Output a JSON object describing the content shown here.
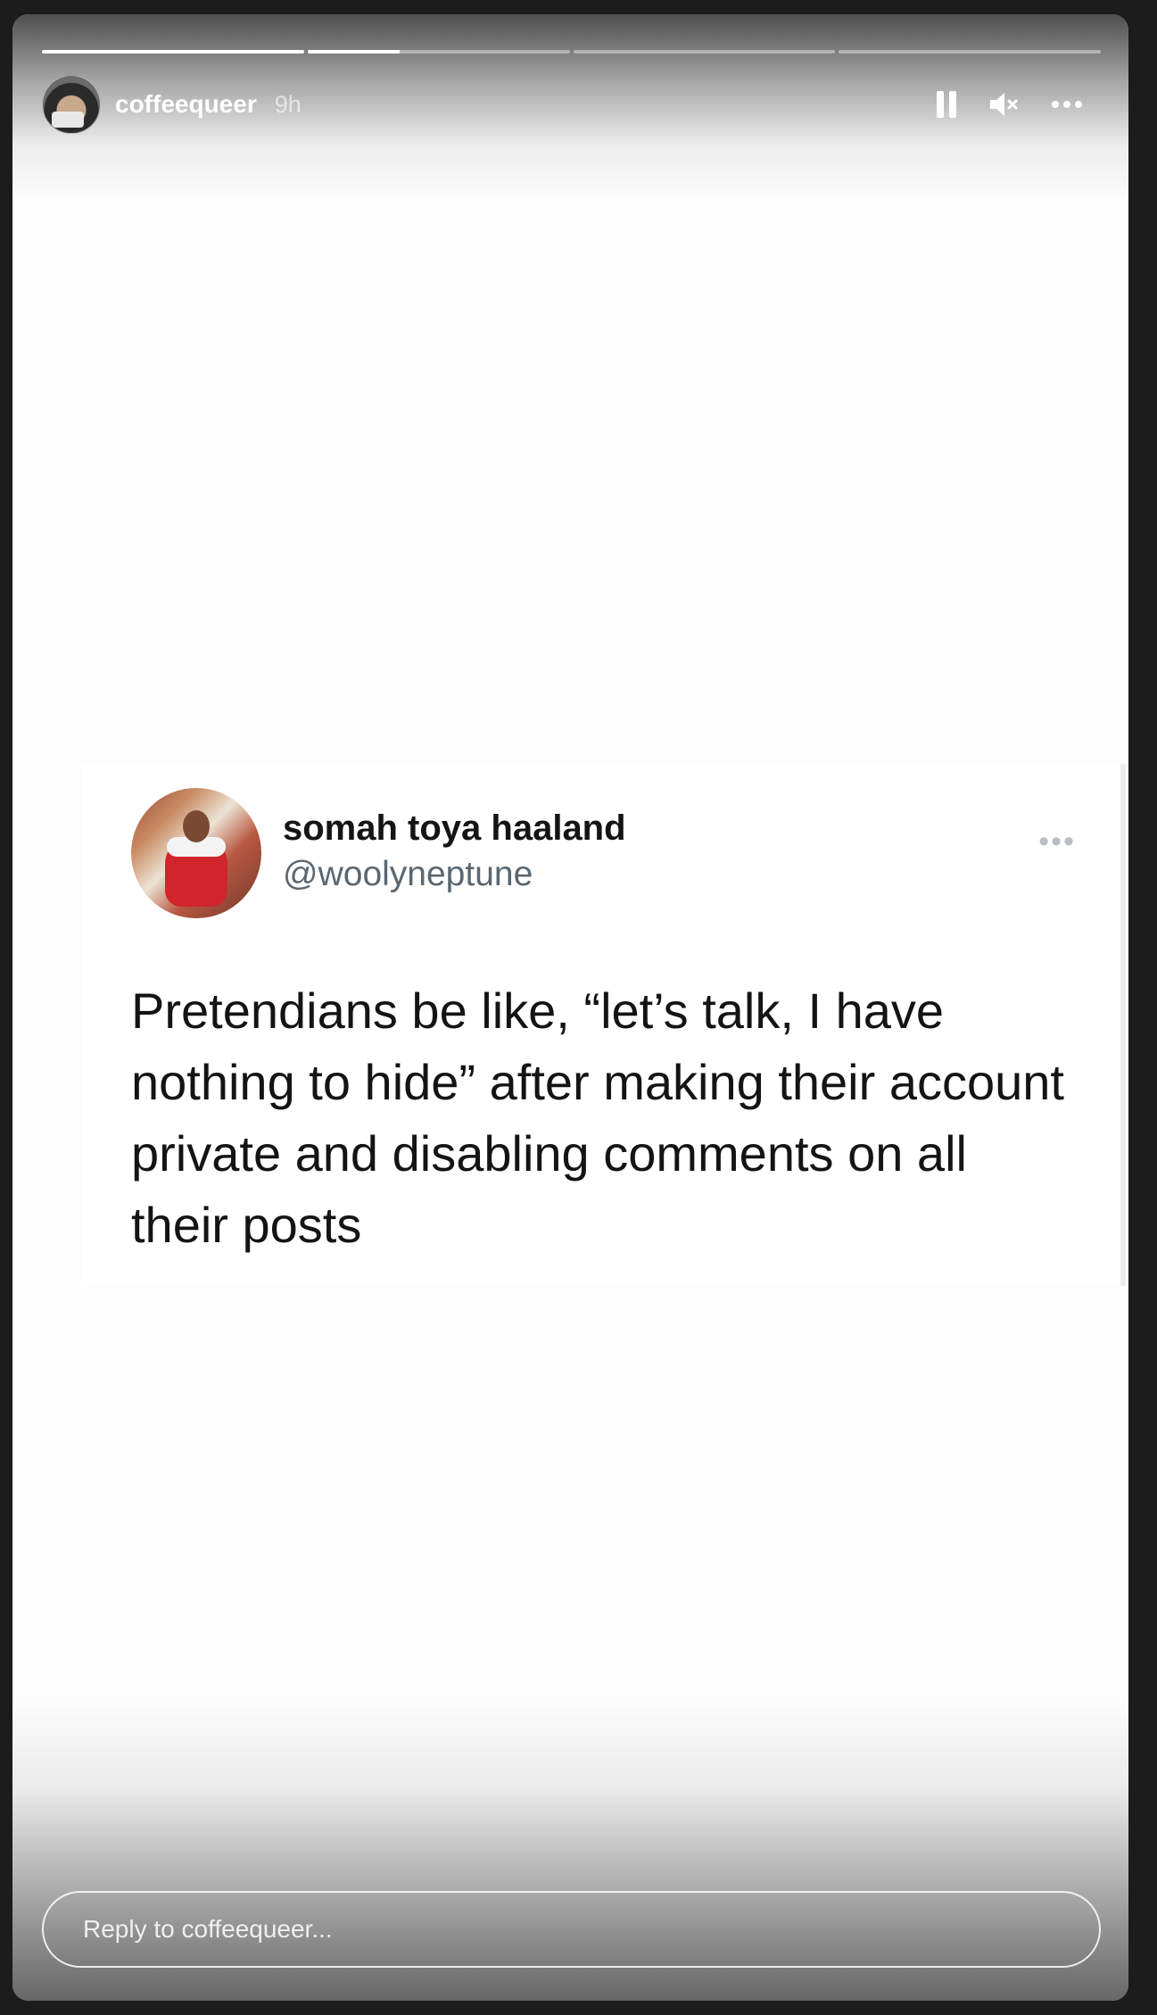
{
  "story": {
    "username": "coffeequeer",
    "time": "9h",
    "progress": [
      1.0,
      0.35,
      0.0,
      0.0
    ],
    "controls": {
      "pause_icon": "pause-icon",
      "mute_icon": "muted-speaker-icon",
      "more_icon": "more-horizontal-icon",
      "more_label": "•••"
    },
    "reply_placeholder": "Reply to coffeequeer..."
  },
  "tweet": {
    "name": "somah toya haaland",
    "handle": "@woolyneptune",
    "more_label": "•••",
    "text": "Pretendians be like, “let’s talk, I have nothing to hide” after making their account private and disabling comments on all their posts"
  },
  "colors": {
    "page_bg": "#1c1c1c",
    "story_bg": "#fdfdfd",
    "handle": "#5b6770",
    "text": "#141414"
  }
}
